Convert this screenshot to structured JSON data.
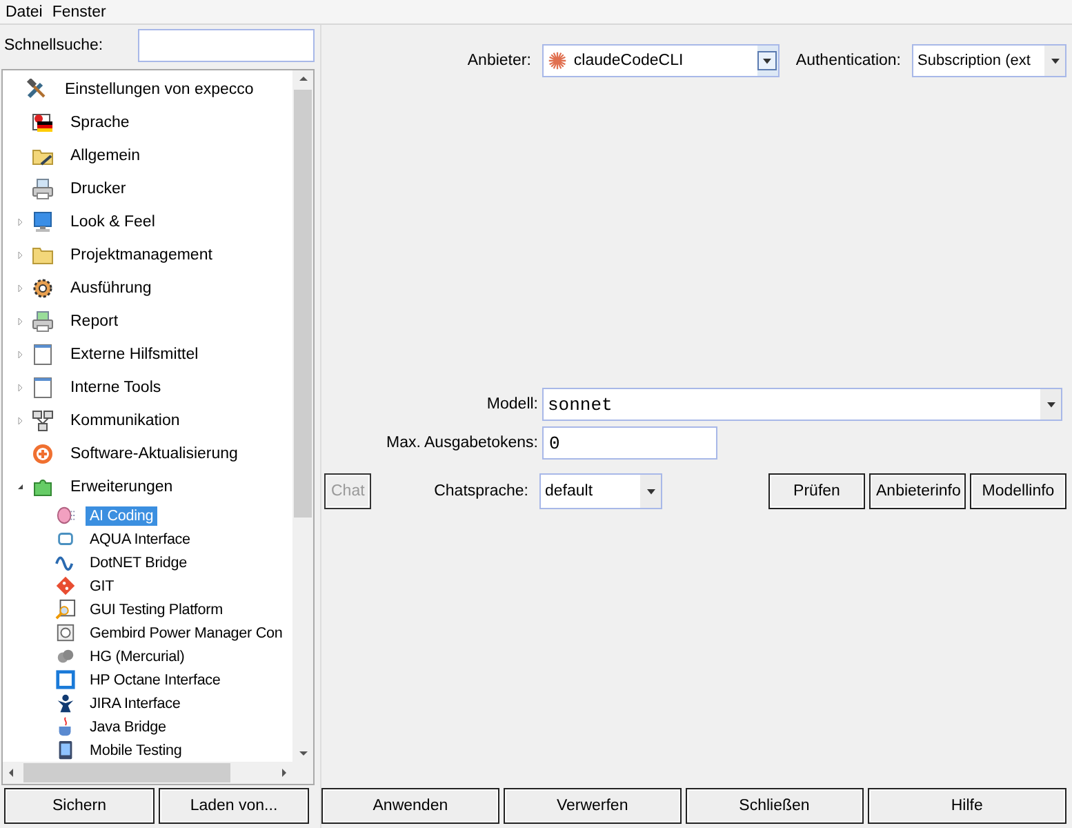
{
  "menu": [
    {
      "label": "Datei"
    },
    {
      "label": "Fenster"
    }
  ],
  "search": {
    "label": "Schnellsuche:"
  },
  "tree": [
    {
      "label": "Einstellungen von expecco",
      "selected": false,
      "children": [
        {
          "label": "Sprache",
          "selected": false
        },
        {
          "label": "Allgemein",
          "selected": false
        },
        {
          "label": "Drucker",
          "selected": false
        },
        {
          "label": "Look & Feel",
          "selected": false,
          "expanded": false
        },
        {
          "label": "Projektmanagement",
          "selected": false,
          "expanded": false
        },
        {
          "label": "Ausführung",
          "selected": false,
          "expanded": false
        },
        {
          "label": "Report",
          "selected": false,
          "expanded": false
        },
        {
          "label": "Externe Hilfsmittel",
          "selected": false,
          "expanded": false
        },
        {
          "label": "Interne Tools",
          "selected": false,
          "expanded": false
        },
        {
          "label": "Kommunikation",
          "selected": false,
          "expanded": false
        },
        {
          "label": "Software-Aktualisierung",
          "selected": false
        },
        {
          "label": "Erweiterungen",
          "selected": false,
          "expanded": true,
          "children": [
            {
              "label": "AI Coding",
              "selected": true
            },
            {
              "label": "AQUA Interface",
              "selected": false
            },
            {
              "label": "DotNET Bridge",
              "selected": false
            },
            {
              "label": "GIT",
              "selected": false
            },
            {
              "label": "GUI Testing Platform",
              "selected": false
            },
            {
              "label": "Gembird Power Manager Con",
              "selected": false
            },
            {
              "label": "HG (Mercurial)",
              "selected": false
            },
            {
              "label": "HP Octane Interface",
              "selected": false
            },
            {
              "label": "JIRA Interface",
              "selected": false
            },
            {
              "label": "Java Bridge",
              "selected": false
            },
            {
              "label": "Mobile Testing",
              "selected": false
            }
          ]
        }
      ]
    }
  ],
  "left_buttons": [
    "Sichern",
    "Laden von..."
  ],
  "provider": {
    "label": "Anbieter:",
    "value": "claudeCodeCLI"
  },
  "authentication": {
    "label": "Authentication:",
    "value": "Subscription (ext"
  },
  "model": {
    "label": "Modell:",
    "value": "sonnet"
  },
  "max_tokens": {
    "label": "Max. Ausgabetokens:",
    "value": "0"
  },
  "chat_button": {
    "label": "Chat",
    "disabled": true
  },
  "chat_language": {
    "label": "Chatsprache:",
    "value": "default"
  },
  "action_buttons": [
    "Prüfen",
    "Anbieterinfo",
    "Modellinfo"
  ],
  "footer_buttons": [
    "Anwenden",
    "Verwerfen",
    "Schließen",
    "Hilfe"
  ]
}
